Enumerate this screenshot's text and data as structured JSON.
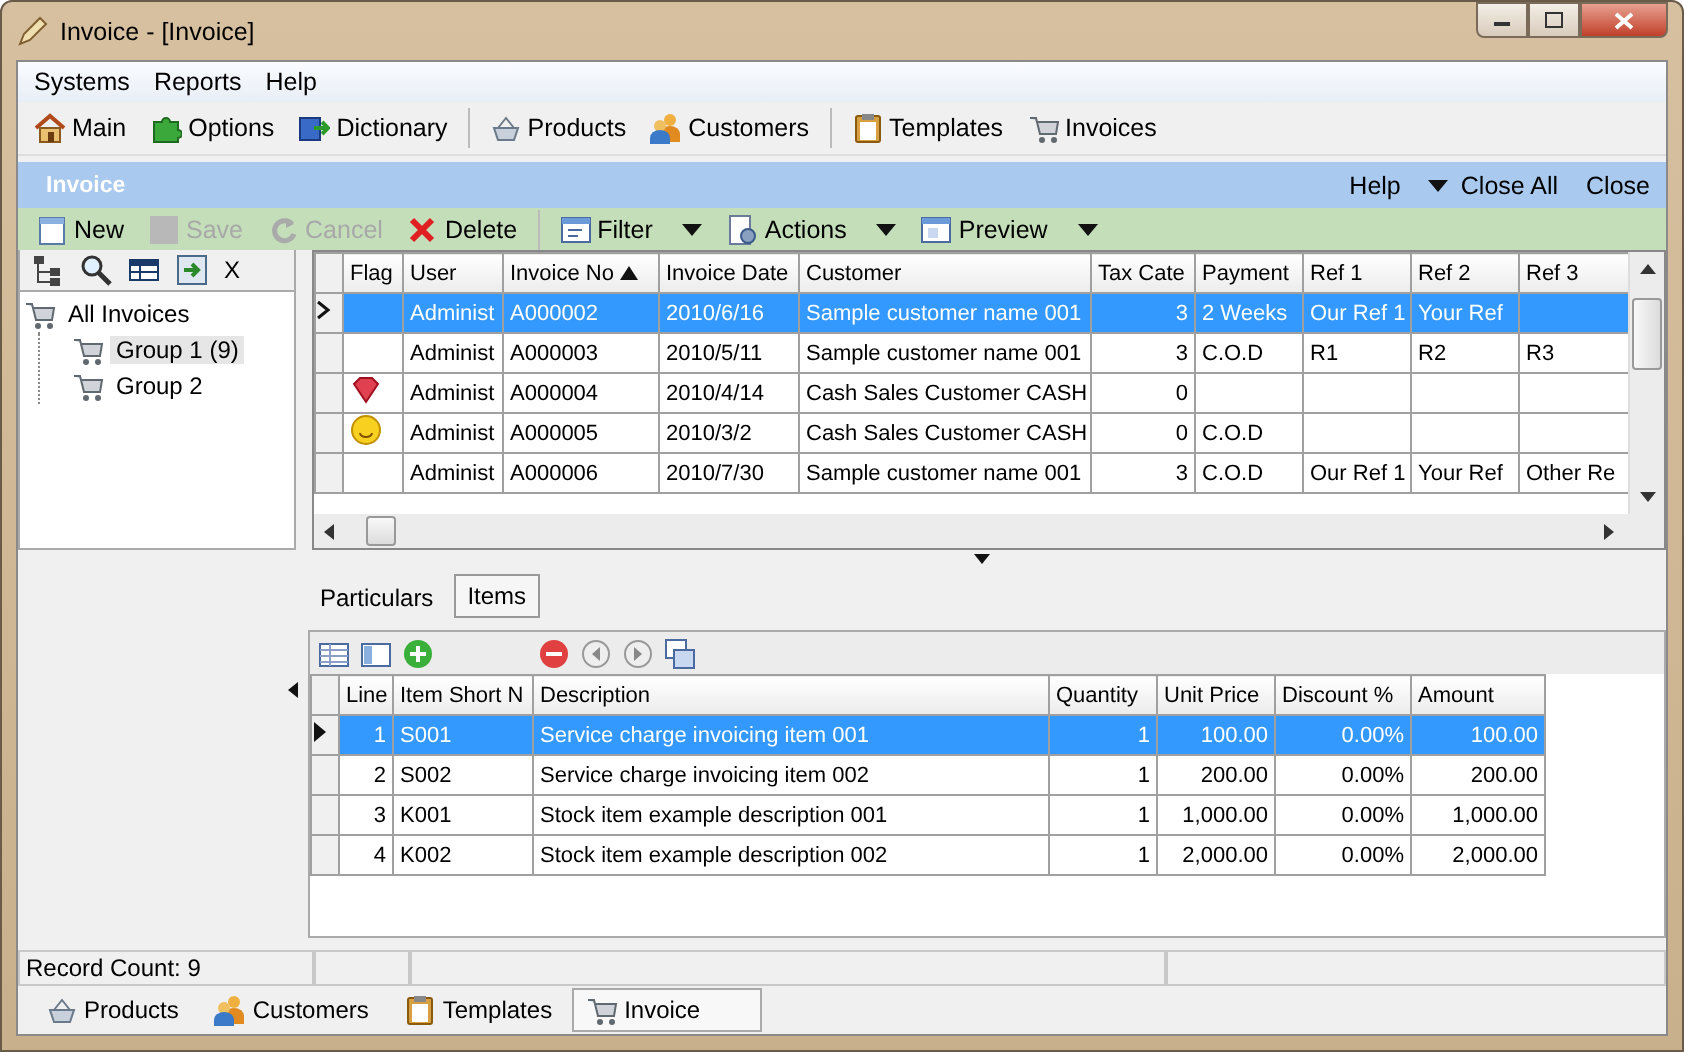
{
  "window": {
    "title": "Invoice - [Invoice]"
  },
  "menu": [
    "Systems",
    "Reports",
    "Help"
  ],
  "toolbar": [
    [
      {
        "label": "Main",
        "kind": "house"
      },
      {
        "label": "Options",
        "kind": "puzzle"
      },
      {
        "label": "Dictionary",
        "kind": "book"
      }
    ],
    [
      {
        "label": "Products",
        "kind": "basket"
      },
      {
        "label": "Customers",
        "kind": "people"
      }
    ],
    [
      {
        "label": "Templates",
        "kind": "clipboard"
      },
      {
        "label": "Invoices",
        "kind": "cart"
      }
    ]
  ],
  "panel": {
    "title": "Invoice",
    "links": [
      {
        "label": "Help",
        "dropdown": false
      },
      {
        "label": "Close All",
        "dropdown": true
      },
      {
        "label": "Close",
        "dropdown": false
      }
    ]
  },
  "actions": [
    {
      "label": "New",
      "kind": "new",
      "disabled": false,
      "dropdown": false
    },
    {
      "label": "Save",
      "kind": "save",
      "disabled": true,
      "dropdown": false
    },
    {
      "label": "Cancel",
      "kind": "cancel",
      "disabled": true,
      "dropdown": false
    },
    {
      "label": "Delete",
      "kind": "delete",
      "disabled": false,
      "dropdown": false
    },
    {
      "label": "Filter",
      "kind": "filter",
      "disabled": false,
      "dropdown": true
    },
    {
      "label": "Actions",
      "kind": "actions",
      "disabled": false,
      "dropdown": true
    },
    {
      "label": "Preview",
      "kind": "preview",
      "disabled": false,
      "dropdown": true
    }
  ],
  "tree_tools": [
    {
      "kind": "tree"
    },
    {
      "kind": "search"
    },
    {
      "kind": "table"
    },
    {
      "kind": "export"
    },
    {
      "kind": "text",
      "label": "X"
    }
  ],
  "tree": [
    {
      "label": "All Invoices",
      "selected": false,
      "children": [
        {
          "label": "Group 1 (9)",
          "selected": true
        },
        {
          "label": "Group 2",
          "selected": false
        }
      ]
    }
  ],
  "invoices": {
    "columns": [
      {
        "label": "Flag"
      },
      {
        "label": "User"
      },
      {
        "label": "Invoice No",
        "sort_ascending": true
      },
      {
        "label": "Invoice Date"
      },
      {
        "label": "Customer"
      },
      {
        "label": "Tax Cate"
      },
      {
        "label": "Payment"
      },
      {
        "label": "Ref 1"
      },
      {
        "label": "Ref 2"
      },
      {
        "label": "Ref 3"
      }
    ],
    "rows": [
      {
        "selected": true,
        "cells": [
          "",
          "Administ",
          "A000002",
          "2010/6/16",
          "Sample customer name 001",
          "3",
          "2 Weeks",
          "Our Ref 1",
          "Your Ref",
          ""
        ]
      },
      {
        "selected": false,
        "cells": [
          "",
          "Administ",
          "A000003",
          "2010/5/11",
          "Sample customer name 001",
          "3",
          "C.O.D",
          "R1",
          "R2",
          "R3"
        ]
      },
      {
        "selected": false,
        "flag": {
          "kind": "gem"
        },
        "cells": [
          "",
          "Administ",
          "A000004",
          "2010/4/14",
          "Cash Sales Customer CASH",
          "0",
          "",
          "",
          "",
          ""
        ]
      },
      {
        "selected": false,
        "flag": {
          "kind": "smiley"
        },
        "cells": [
          "",
          "Administ",
          "A000005",
          "2010/3/2",
          "Cash Sales Customer CASH",
          "0",
          "C.O.D",
          "",
          "",
          ""
        ]
      },
      {
        "selected": false,
        "cells": [
          "",
          "Administ",
          "A000006",
          "2010/7/30",
          "Sample customer name 001",
          "3",
          "C.O.D",
          "Our Ref 1",
          "Your Ref",
          "Other Re"
        ]
      }
    ]
  },
  "detail_tabs": [
    {
      "label": "Particulars",
      "selected": false
    },
    {
      "label": "Items",
      "selected": true
    }
  ],
  "item_tools": [
    [
      {
        "kind": "grid"
      },
      {
        "kind": "form"
      },
      {
        "kind": "add"
      }
    ],
    [
      {
        "kind": "remove"
      },
      {
        "kind": "prev"
      },
      {
        "kind": "next"
      },
      {
        "kind": "copy"
      }
    ]
  ],
  "items": {
    "columns": [
      "Line",
      "Item Short N",
      "Description",
      "Quantity",
      "Unit Price",
      "Discount %",
      "Amount"
    ],
    "rows": [
      {
        "selected": true,
        "cells": [
          "1",
          "S001",
          "Service charge invoicing item 001",
          "1",
          "100.00",
          "0.00%",
          "100.00"
        ]
      },
      {
        "selected": false,
        "cells": [
          "2",
          "S002",
          "Service charge invoicing item 002",
          "1",
          "200.00",
          "0.00%",
          "200.00"
        ]
      },
      {
        "selected": false,
        "cells": [
          "3",
          "K001",
          "Stock item example description 001",
          "1",
          "1,000.00",
          "0.00%",
          "1,000.00"
        ]
      },
      {
        "selected": false,
        "cells": [
          "4",
          "K002",
          "Stock item example description 002",
          "1",
          "2,000.00",
          "0.00%",
          "2,000.00"
        ]
      }
    ]
  },
  "status_bar": [
    "Record Count: 9"
  ],
  "bottom_tabs": [
    {
      "label": "Products",
      "kind": "basket",
      "selected": false
    },
    {
      "label": "Customers",
      "kind": "people",
      "selected": false
    },
    {
      "label": "Templates",
      "kind": "clipboard",
      "selected": false
    },
    {
      "label": "Invoice",
      "kind": "cart",
      "selected": true
    }
  ]
}
